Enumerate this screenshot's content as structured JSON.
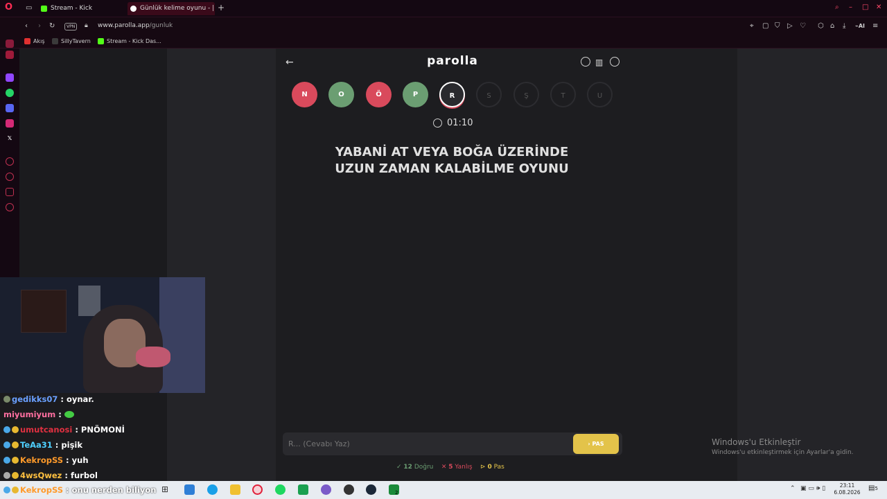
{
  "browser": {
    "tabs": [
      {
        "label": "Stream - Kick Dashboard",
        "icon": "kick-icon"
      },
      {
        "label": "Günlük kelime oyunu - |",
        "icon": "parolla-icon"
      }
    ],
    "address": {
      "host": "www.parolla.app",
      "path": "/gunluk"
    },
    "vpn_label": "VPN",
    "bookmarks": [
      "Akış",
      "SillyTavern",
      "Stream - Kick Das..."
    ],
    "ai_label": "AI"
  },
  "game": {
    "title": "parolla",
    "letters": [
      {
        "letter": "N",
        "state": "wrong"
      },
      {
        "letter": "O",
        "state": "correct"
      },
      {
        "letter": "Ö",
        "state": "wrong"
      },
      {
        "letter": "P",
        "state": "correct"
      },
      {
        "letter": "R",
        "state": "active"
      },
      {
        "letter": "S",
        "state": "empty"
      },
      {
        "letter": "Ş",
        "state": "empty"
      },
      {
        "letter": "T",
        "state": "empty"
      },
      {
        "letter": "U",
        "state": "empty"
      }
    ],
    "timer": "01:10",
    "question_line1": "YABANİ AT VEYA BOĞA ÜZERİNDE",
    "question_line2": "UZUN ZAMAN KALABİLME OYUNU",
    "answer_placeholder": "R... (Cevabı Yaz)",
    "pass_button": "PAS",
    "stats": {
      "correct_count": "12",
      "correct_label": "Doğru",
      "wrong_count": "5",
      "wrong_label": "Yanlış",
      "pass_count": "0",
      "pass_label": "Pas"
    }
  },
  "chat": [
    {
      "user": "gedikks07",
      "text": ": oynar.",
      "color": "#6aa0ff"
    },
    {
      "user": "miyumiyum",
      "text": ":",
      "color": "#ff6fa0"
    },
    {
      "user": "umutcanosi",
      "text": ": PNÖMONİ",
      "color": "#e03040"
    },
    {
      "user": "TeAa31",
      "text": ": pişik",
      "color": "#4fd0ff"
    },
    {
      "user": "KekropSS",
      "text": ": yuh",
      "color": "#ff9a2a"
    },
    {
      "user": "4wsQwez",
      "text": ": furbol",
      "color": "#ffc040"
    },
    {
      "user": "KekropSS",
      "text": ": onu nerden biliyon",
      "color": "#ff9a2a"
    }
  ],
  "windows": {
    "activation_title": "Windows'u Etkinleştir",
    "activation_sub": "Windows'u etkinleştirmek için Ayarlar'a gidin.",
    "time": "23:11",
    "date": "6.08.2026",
    "notif_count": "5",
    "steam_badge": "2"
  },
  "colors": {
    "wrong": "#d94a5c",
    "correct": "#6b9e72",
    "pass_button": "#e3c34a"
  }
}
